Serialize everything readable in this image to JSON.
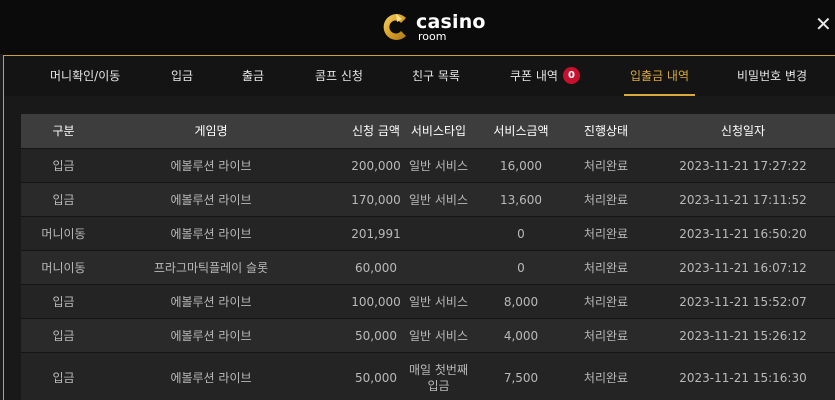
{
  "brand": {
    "name": "casino",
    "sub": "room"
  },
  "tabs": [
    {
      "label": "머니확인/이동"
    },
    {
      "label": "입금"
    },
    {
      "label": "출금"
    },
    {
      "label": "콤프 신청"
    },
    {
      "label": "친구 목록"
    },
    {
      "label": "쿠폰 내역",
      "badge": "0"
    },
    {
      "label": "입출금 내역",
      "active": true
    },
    {
      "label": "비밀번호 변경"
    }
  ],
  "table": {
    "headers": [
      "구분",
      "게임명",
      "신청 금액",
      "서비스타입",
      "서비스금액",
      "진행상태",
      "신청일자"
    ],
    "rows": [
      [
        "입금",
        "에볼루션 라이브",
        "200,000",
        "일반 서비스",
        "16,000",
        "처리완료",
        "2023-11-21 17:27:22"
      ],
      [
        "입금",
        "에볼루션 라이브",
        "170,000",
        "일반 서비스",
        "13,600",
        "처리완료",
        "2023-11-21 17:11:52"
      ],
      [
        "머니이동",
        "에볼루션 라이브",
        "201,991",
        "",
        "0",
        "처리완료",
        "2023-11-21 16:50:20"
      ],
      [
        "머니이동",
        "프라그마틱플레이 슬롯",
        "60,000",
        "",
        "0",
        "처리완료",
        "2023-11-21 16:07:12"
      ],
      [
        "입금",
        "에볼루션 라이브",
        "100,000",
        "일반 서비스",
        "8,000",
        "처리완료",
        "2023-11-21 15:52:07"
      ],
      [
        "입금",
        "에볼루션 라이브",
        "50,000",
        "일반 서비스",
        "4,000",
        "처리완료",
        "2023-11-21 15:26:12"
      ],
      [
        "입금",
        "에볼루션 라이브",
        "50,000",
        "매일 첫번째 입금",
        "7,500",
        "처리완료",
        "2023-11-21 15:16:30"
      ]
    ]
  },
  "icons": {
    "close": "close-icon",
    "logo": "casino-logo-icon"
  },
  "colors": {
    "accent": "#d9a93a",
    "badge": "#c8102e",
    "header_row": "#3d3d3d"
  }
}
